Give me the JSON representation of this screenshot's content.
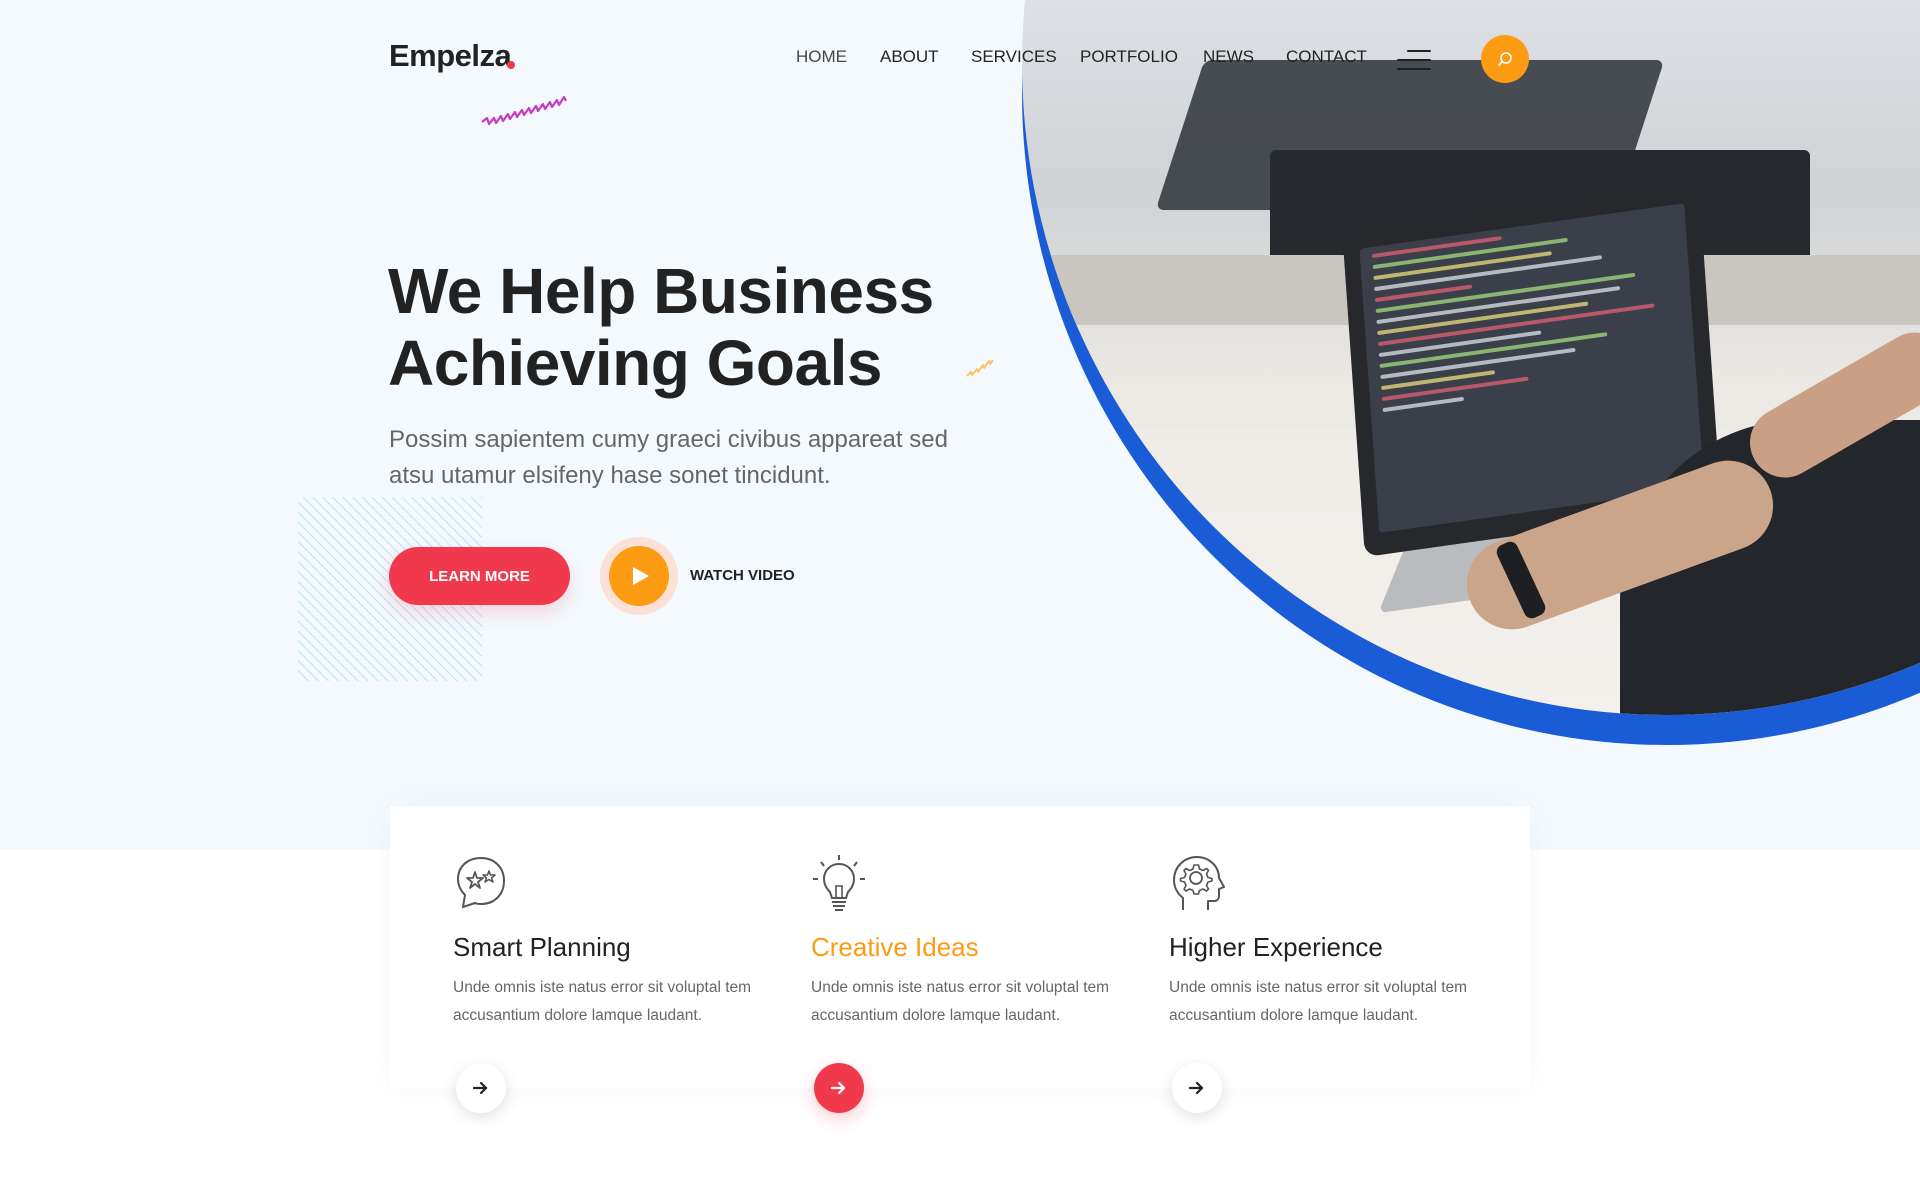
{
  "brand": {
    "name": "Empelza",
    "dot_color": "#f1394e"
  },
  "nav": {
    "items": [
      {
        "label": "HOME",
        "active": true
      },
      {
        "label": "ABOUT",
        "active": false
      },
      {
        "label": "SERVICES",
        "active": false
      },
      {
        "label": "PORTFOLIO",
        "active": false
      },
      {
        "label": "NEWS",
        "active": false
      },
      {
        "label": "CONTACT",
        "active": false
      }
    ],
    "menu_icon": "hamburger-icon",
    "search_icon": "search-icon"
  },
  "hero": {
    "title_line1": "We Help Business",
    "title_line2": "Achieving Goals",
    "text": "Possim sapientem cumy graeci civibus appareat sed atsu utamur elsifeny hase sonet tincidunt.",
    "learn_more": "LEARN MORE",
    "watch_video": "WATCH VIDEO",
    "image": "laptop-with-code-photo"
  },
  "features": [
    {
      "title": "Smart Planning",
      "text": "Unde omnis iste natus error sit voluptal tem accusantium dolore lamque laudant.",
      "icon": "head-stars-icon",
      "highlight": false
    },
    {
      "title": "Creative Ideas",
      "text": "Unde omnis iste natus error sit voluptal tem accusantium dolore lamque laudant.",
      "icon": "lightbulb-icon",
      "highlight": true
    },
    {
      "title": "Higher Experience",
      "text": "Unde omnis iste natus error sit voluptal tem accusantium dolore lamque laudant.",
      "icon": "head-gear-icon",
      "highlight": false
    }
  ],
  "colors": {
    "primary": "#f1394e",
    "accent": "#fd9b13",
    "blue": "#1a5bd6",
    "hero_bg": "#f3f9fd"
  }
}
